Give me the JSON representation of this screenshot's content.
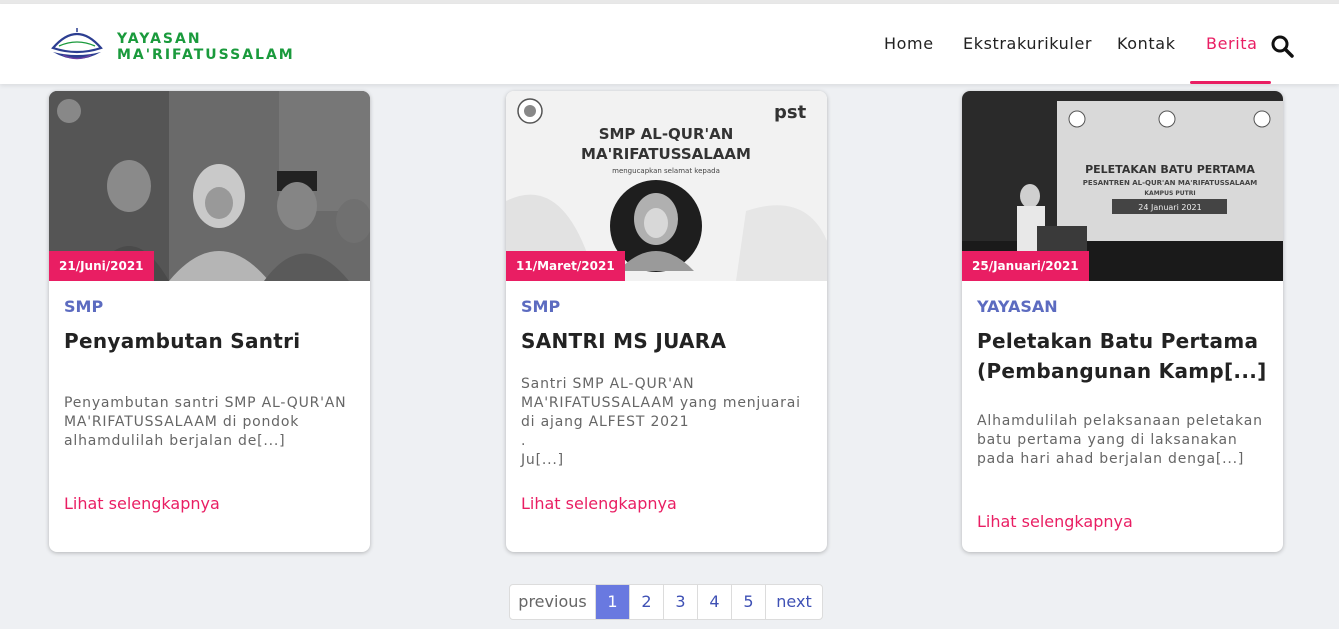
{
  "header": {
    "brand_line1": "YAYASAN",
    "brand_line2": "MA'RIFATUSSALAM",
    "nav": [
      "Home",
      "Ekstrakurikuler",
      "Kontak",
      "Berita"
    ],
    "active_nav": "Berita",
    "icons": {
      "logo": "mosque-dome-logo",
      "search": "search-icon"
    }
  },
  "colors": {
    "accent": "#e91e63",
    "category": "#5c6bc0",
    "brand": "#1a9a3c",
    "pager_active": "#6979e0"
  },
  "cards": [
    {
      "date": "21/Juni/2021",
      "category": "SMP",
      "title": "Penyambutan Santri",
      "excerpt": "Penyambutan santri SMP AL-QUR'AN MA'RIFATUSSALAAM di pondok alhamdulilah berjalan de[...]",
      "more": "Lihat selengkapnya"
    },
    {
      "date": "11/Maret/2021",
      "category": "SMP",
      "title": "SANTRI MS JUARA",
      "excerpt": "Santri SMP AL-QUR'AN MA'RIFATUSSALAAM yang menjuarai di ajang ALFEST 2021\n.\nJu[...]",
      "more": "Lihat selengkapnya",
      "image_text": {
        "heading1": "SMP AL-QUR'AN",
        "heading2": "MA'RIFATUSSALAAM",
        "sub": "mengucapkan selamat kepada",
        "logo": "pst"
      }
    },
    {
      "date": "25/Januari/2021",
      "category": "YAYASAN",
      "title": "Peletakan Batu Pertama (Pembangunan Kamp[...]",
      "excerpt": "Alhamdulilah pelaksanaan peletakan batu pertama yang di laksanakan pada hari ahad berjalan denga[...]",
      "more": "Lihat selengkapnya",
      "image_text": {
        "banner1": "PELETAKAN BATU PERTAMA",
        "banner2": "PESANTREN AL-QUR'AN MA'RIFATUSSALAAM",
        "banner3": "KAMPUS PUTRI",
        "banner_date": "24 Januari 2021"
      }
    }
  ],
  "pagination": {
    "previous": "previous",
    "pages": [
      "1",
      "2",
      "3",
      "4",
      "5"
    ],
    "current": "1",
    "next": "next"
  }
}
